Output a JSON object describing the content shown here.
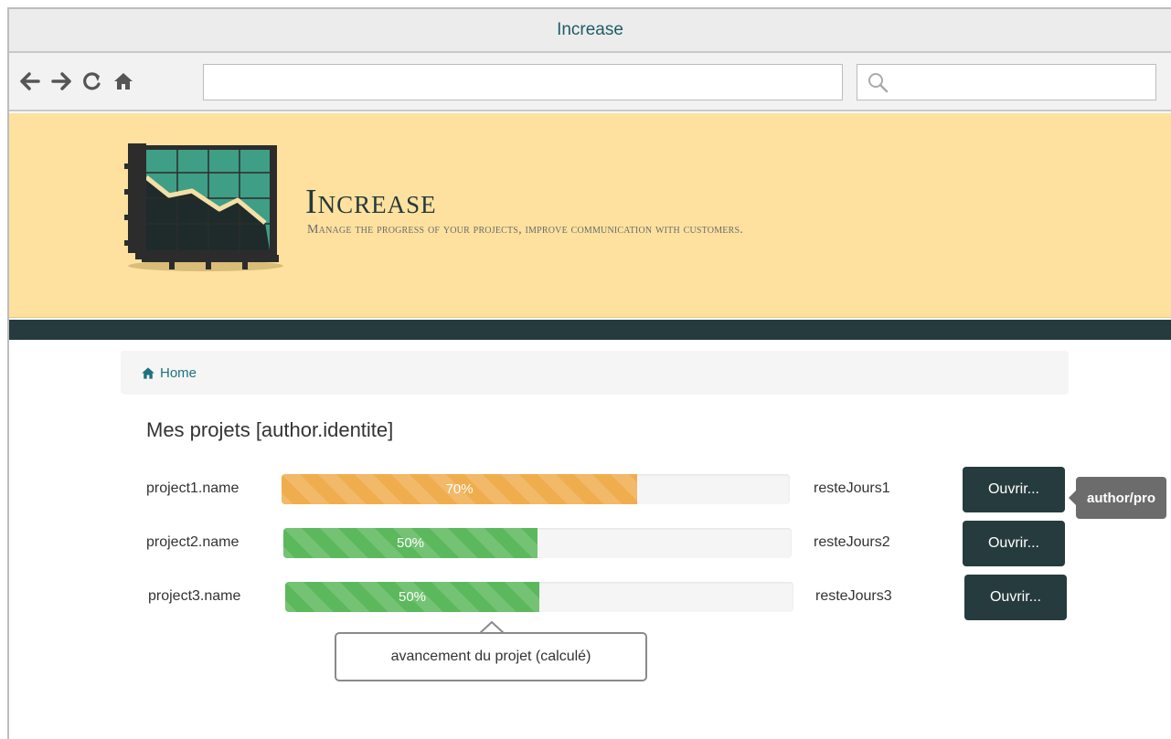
{
  "window": {
    "title": "Increase"
  },
  "toolbar": {
    "back_icon": "arrow-left-icon",
    "forward_icon": "arrow-right-icon",
    "reload_icon": "reload-icon",
    "home_icon": "home-icon",
    "url_value": "",
    "search_value": "",
    "search_icon": "search-icon"
  },
  "banner": {
    "title": "Increase",
    "subtitle": "Manage the progress of your projects, improve communication with customers.",
    "accent_color": "#ffe19f",
    "dark_color": "#263b3d"
  },
  "breadcrumb": {
    "home_label": "Home"
  },
  "main": {
    "title": "Mes projets [author.identite]",
    "projects": [
      {
        "name": "project1.name",
        "progress": 70,
        "progress_label": "70%",
        "status_color": "#f0ad4e",
        "remaining": "resteJours1",
        "open_label": "Ouvrir..."
      },
      {
        "name": "project2.name",
        "progress": 50,
        "progress_label": "50%",
        "status_color": "#5cb85c",
        "remaining": "resteJours2",
        "open_label": "Ouvrir..."
      },
      {
        "name": "project3.name",
        "progress": 50,
        "progress_label": "50%",
        "status_color": "#5cb85c",
        "remaining": "resteJours3",
        "open_label": "Ouvrir..."
      }
    ]
  },
  "tooltip": {
    "text": "author/pro"
  },
  "callout": {
    "text": "avancement du projet (calculé)"
  }
}
